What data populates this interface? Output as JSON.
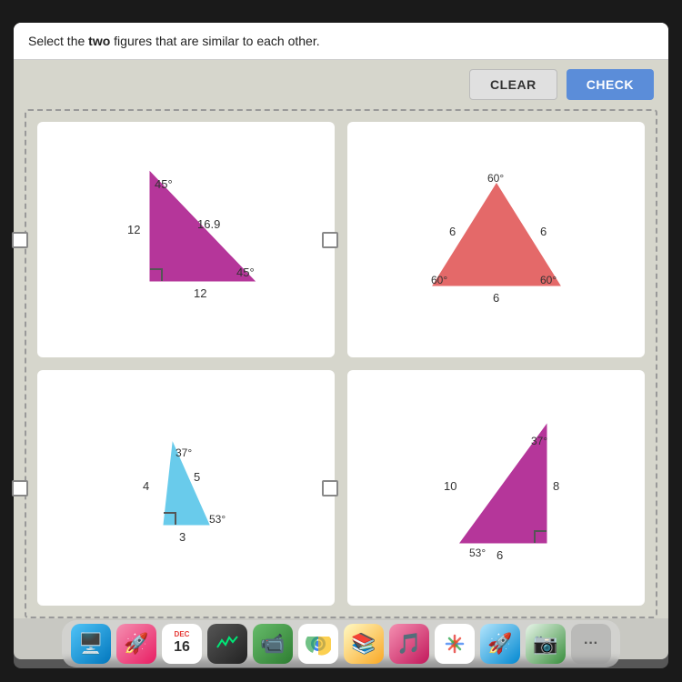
{
  "header": {
    "instruction": "Select the ",
    "instruction_bold": "two",
    "instruction_end": " figures that are similar to each other."
  },
  "toolbar": {
    "clear_label": "CLEAR",
    "check_label": "CHECK"
  },
  "figures": [
    {
      "id": "fig1",
      "type": "right-isosceles",
      "angles": [
        "45°",
        "45°",
        "90°"
      ],
      "sides": [
        "12",
        "16.9",
        "12"
      ],
      "color": "#b5369a"
    },
    {
      "id": "fig2",
      "type": "equilateral",
      "angles": [
        "60°",
        "60°",
        "60°"
      ],
      "sides": [
        "6",
        "6",
        "6"
      ],
      "color": "#e05050"
    },
    {
      "id": "fig3",
      "type": "right-scalene-small",
      "angles": [
        "37°",
        "53°",
        "90°"
      ],
      "sides": [
        "4",
        "5",
        "3"
      ],
      "color": "#4fc3e8"
    },
    {
      "id": "fig4",
      "type": "right-scalene-large",
      "angles": [
        "37°",
        "53°",
        "90°"
      ],
      "sides": [
        "10",
        "8",
        "6"
      ],
      "color": "#b5369a"
    }
  ],
  "dock": {
    "date": "16",
    "items": [
      {
        "name": "finder",
        "icon": "🔵"
      },
      {
        "name": "launchpad",
        "icon": "🚀"
      },
      {
        "name": "calendar",
        "icon": "📅"
      },
      {
        "name": "activity-monitor",
        "icon": "📊"
      },
      {
        "name": "facetime",
        "icon": "📹"
      },
      {
        "name": "chrome",
        "icon": "🌐"
      },
      {
        "name": "books",
        "icon": "📚"
      },
      {
        "name": "music",
        "icon": "🎵"
      },
      {
        "name": "photos",
        "icon": "🖼️"
      },
      {
        "name": "rocket",
        "icon": "🚀"
      },
      {
        "name": "image-capture",
        "icon": "📷"
      },
      {
        "name": "more",
        "icon": "···"
      }
    ]
  }
}
